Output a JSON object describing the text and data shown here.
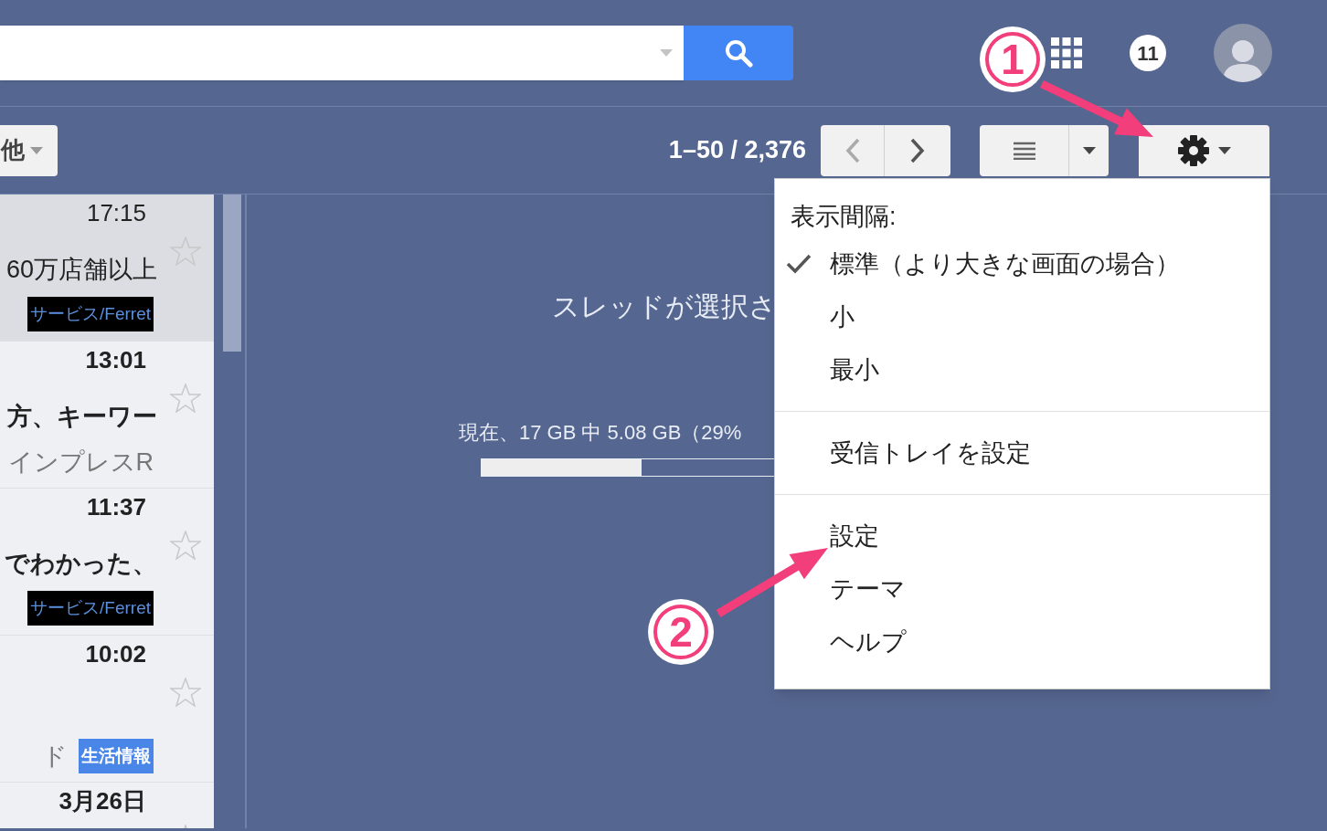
{
  "header": {
    "notification_count": "11"
  },
  "toolbar": {
    "more_button": "他",
    "pager": "1–50 / 2,376"
  },
  "messages": [
    {
      "time": "17:15",
      "subject": "60万店舗以上",
      "label": {
        "text": "サービス/Ferret",
        "color": "#000000"
      },
      "unread": false
    },
    {
      "time": "13:01",
      "subject": "方、キーワー",
      "snippet": "インプレスR",
      "unread": true
    },
    {
      "time": "11:37",
      "subject": "でわかった、",
      "label": {
        "text": "サービス/Ferret",
        "color": "#000000"
      },
      "unread": true
    },
    {
      "time": "10:02",
      "snippet": "ド",
      "label": {
        "text": "生活情報",
        "color": "#4a86e8"
      },
      "unread": true
    },
    {
      "time": "3月26日",
      "unread": true
    }
  ],
  "main": {
    "empty_message": "スレッドが選択さ",
    "storage_text": "現在、17 GB 中 5.08 GB（29%",
    "storage_bar": {
      "level": 0.29
    }
  },
  "settings_menu": [
    {
      "kind": "header",
      "label": "表示間隔:"
    },
    {
      "kind": "option",
      "label": "標準（より大きな画面の場合）",
      "checked": true
    },
    {
      "kind": "option",
      "label": "小",
      "checked": false
    },
    {
      "kind": "option",
      "label": "最小",
      "checked": false
    },
    {
      "kind": "divider"
    },
    {
      "kind": "action",
      "label": "受信トレイを設定"
    },
    {
      "kind": "divider"
    },
    {
      "kind": "action",
      "label": "設定"
    },
    {
      "kind": "action",
      "label": "テーマ"
    },
    {
      "kind": "action",
      "label": "ヘルプ"
    }
  ],
  "annotations": [
    {
      "label": "1"
    },
    {
      "label": "2"
    }
  ]
}
